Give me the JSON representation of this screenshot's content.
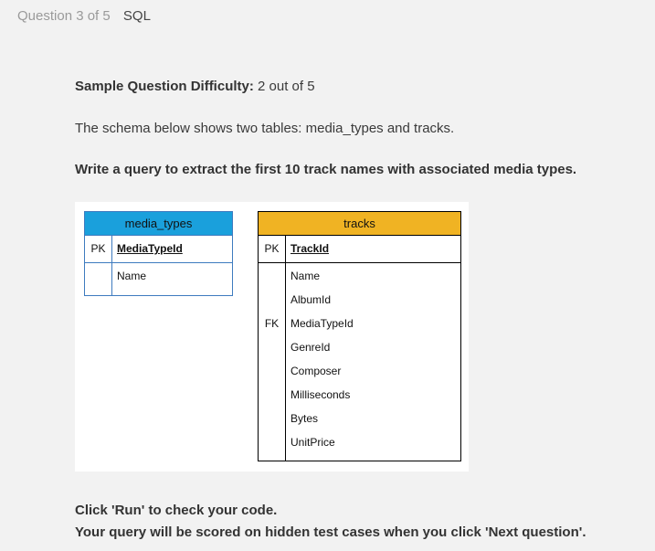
{
  "header": {
    "question_progress": "Question 3 of 5",
    "section": "SQL"
  },
  "question": {
    "difficulty_label": "Sample Question Difficulty:",
    "difficulty_value": "2 out of 5",
    "description": "The schema below shows two tables: media_types and tracks.",
    "task": "Write a query to extract the first 10 track names with associated media types."
  },
  "schema": {
    "media_types": {
      "title": "media_types",
      "header_color": "#1aa0dc",
      "pk_label": "PK",
      "pk_field": "MediaTypeId",
      "fields": [
        "Name"
      ]
    },
    "tracks": {
      "title": "tracks",
      "header_color": "#f0b323",
      "pk_label": "PK",
      "pk_field": "TrackId",
      "fields": [
        {
          "key": "",
          "name": "Name"
        },
        {
          "key": "",
          "name": "AlbumId"
        },
        {
          "key": "FK",
          "name": "MediaTypeId"
        },
        {
          "key": "",
          "name": "GenreId"
        },
        {
          "key": "",
          "name": "Composer"
        },
        {
          "key": "",
          "name": "Milliseconds"
        },
        {
          "key": "",
          "name": "Bytes"
        },
        {
          "key": "",
          "name": "UnitPrice"
        }
      ]
    }
  },
  "footer": {
    "line1": "Click 'Run' to check your code.",
    "line2": "Your query will be scored on hidden test cases when you click 'Next question'."
  }
}
